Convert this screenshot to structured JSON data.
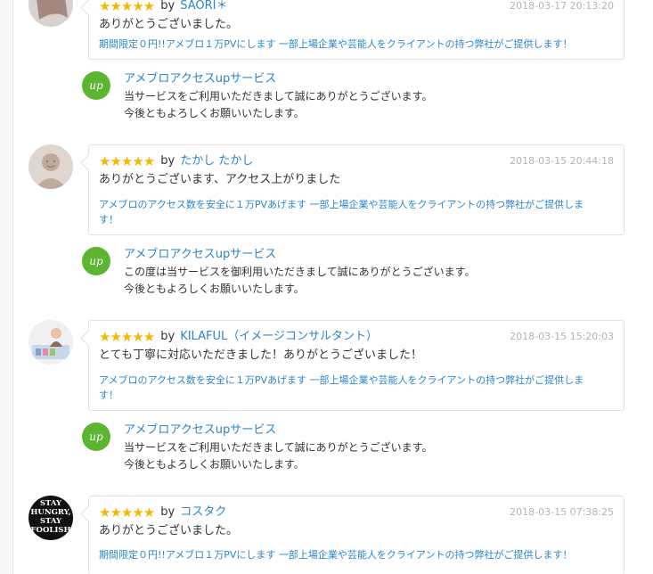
{
  "reviews": [
    {
      "stars": "★★★★★",
      "by": "by",
      "user": "SAORI＊",
      "date": "2018-03-17 20:13:20",
      "comment": "ありがとうございました。",
      "service_lines": [
        "期間限定０円!!アメブロ１万PVにします 一部上場企業や芸能人をクライアントの持つ弊社がご提供します！"
      ]
    },
    {
      "stars": "★★★★★",
      "by": "by",
      "user": "たかし たかし",
      "date": "2018-03-15 20:44:18",
      "comment": "ありがとうございます、アクセス上がりました",
      "service_lines": [
        "アメブロのアクセス数を安全に１万PVあげます 一部上場企業や芸能人をクライアントの持つ弊社がご提供しま",
        "す！"
      ]
    },
    {
      "stars": "★★★★★",
      "by": "by",
      "user": "KILAFUL（イメージコンサルタント）",
      "date": "2018-03-15 15:20:03",
      "comment": "とても丁寧に対応いただきました！ありがとうございました！",
      "service_lines": [
        "アメブロのアクセス数を安全に１万PVあげます 一部上場企業や芸能人をクライアントの持つ弊社がご提供しま",
        "す！"
      ]
    },
    {
      "stars": "★★★★★",
      "by": "by",
      "user": "コスタク",
      "date": "2018-03-15 07:38:25",
      "comment": "ありがとうございました。",
      "service_lines": [
        "期間限定０円!!アメブロ１万PVにします 一部上場企業や芸能人をクライアントの持つ弊社がご提供します！"
      ]
    }
  ],
  "replies": [
    {
      "icon": "up",
      "name": "アメブロアクセスupサービス",
      "lines": [
        "当サービスをご利用いただきまして誠にありがとうございます。",
        "今後ともよろしくお願いいたします。"
      ]
    },
    {
      "icon": "up",
      "name": "アメブロアクセスupサービス",
      "lines": [
        "この度は当サービスを御利用いただきまして誠にありがとうございます。",
        "今後ともよろしくお願いいたします。"
      ]
    },
    {
      "icon": "up",
      "name": "アメブロアクセスupサービス",
      "lines": [
        "当サービスをご利用いただきまして誠にありがとうございます。",
        "今後ともよろしくお願いいたします。"
      ]
    }
  ],
  "avatar_badge_lines": [
    "STAY",
    "HUNGRY,",
    "STAY",
    "FOOLISH"
  ],
  "colors": {
    "link": "#2a86c8",
    "star": "#f3b800",
    "reply_icon": "#5cb531",
    "date": "#b4b4b4"
  }
}
